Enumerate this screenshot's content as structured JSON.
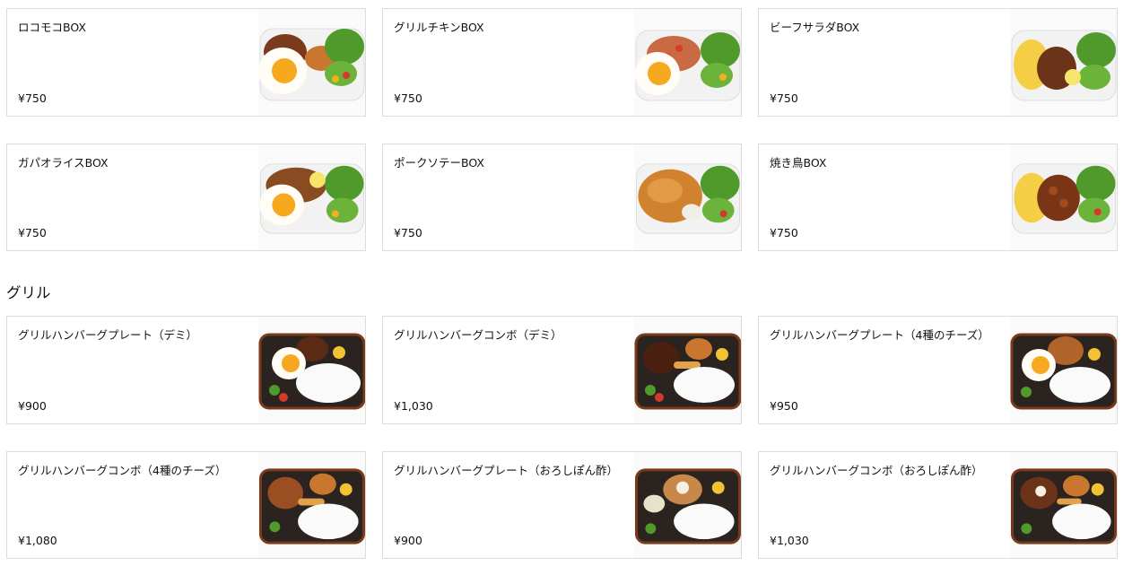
{
  "sections": [
    {
      "title": "",
      "items": [
        {
          "name": "ロコモコBOX",
          "price": "¥750",
          "image": "locomoco-box-photo"
        },
        {
          "name": "グリルチキンBOX",
          "price": "¥750",
          "image": "grill-chicken-box-photo"
        },
        {
          "name": "ビーフサラダBOX",
          "price": "¥750",
          "image": "beef-salad-box-photo"
        },
        {
          "name": "ガパオライスBOX",
          "price": "¥750",
          "image": "gapao-rice-box-photo"
        },
        {
          "name": "ポークソテーBOX",
          "price": "¥750",
          "image": "pork-saute-box-photo"
        },
        {
          "name": "焼き鳥BOX",
          "price": "¥750",
          "image": "yakitori-box-photo"
        }
      ]
    },
    {
      "title": "グリル",
      "items": [
        {
          "name": "グリルハンバーグプレート（デミ）",
          "price": "¥900",
          "image": "grill-hamburg-plate-demi-photo"
        },
        {
          "name": "グリルハンバーグコンボ（デミ）",
          "price": "¥1,030",
          "image": "grill-hamburg-combo-demi-photo"
        },
        {
          "name": "グリルハンバーグプレート（4種のチーズ）",
          "price": "¥950",
          "image": "grill-hamburg-plate-cheese-photo"
        },
        {
          "name": "グリルハンバーグコンボ（4種のチーズ）",
          "price": "¥1,080",
          "image": "grill-hamburg-combo-cheese-photo"
        },
        {
          "name": "グリルハンバーグプレート（おろしぽん酢）",
          "price": "¥900",
          "image": "grill-hamburg-plate-ponzu-photo"
        },
        {
          "name": "グリルハンバーグコンボ（おろしぽん酢）",
          "price": "¥1,030",
          "image": "grill-hamburg-combo-ponzu-photo"
        }
      ]
    }
  ]
}
